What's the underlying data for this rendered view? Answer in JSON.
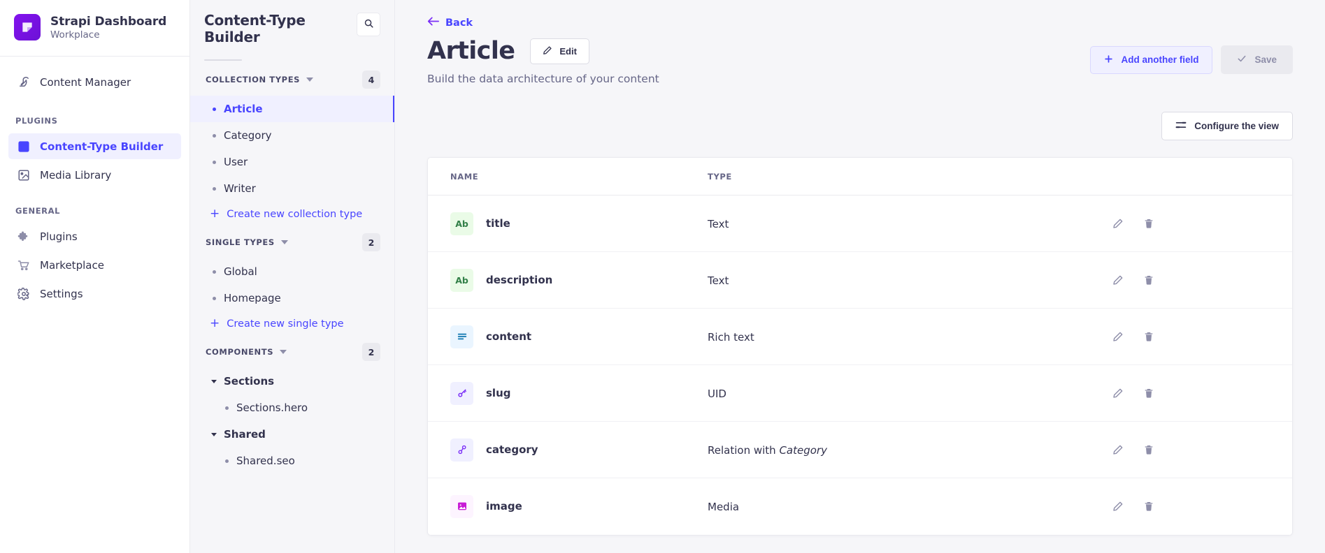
{
  "brand": {
    "title": "Strapi Dashboard",
    "subtitle": "Workplace",
    "logo_icon": "strapi-logo-icon",
    "accent": "#4945ff",
    "brand_purple": "#7b2ff7"
  },
  "mainnav": {
    "top_items": [
      {
        "label": "Content Manager",
        "icon": "feather-icon"
      }
    ],
    "groups": [
      {
        "label": "PLUGINS",
        "items": [
          {
            "label": "Content-Type Builder",
            "icon": "layout-icon",
            "active": true
          },
          {
            "label": "Media Library",
            "icon": "image-icon",
            "active": false
          }
        ]
      },
      {
        "label": "GENERAL",
        "items": [
          {
            "label": "Plugins",
            "icon": "puzzle-icon",
            "active": false
          },
          {
            "label": "Marketplace",
            "icon": "shopping-cart-icon",
            "active": false
          },
          {
            "label": "Settings",
            "icon": "gear-icon",
            "active": false
          }
        ]
      }
    ]
  },
  "subnav": {
    "title": "Content-Type Builder",
    "search_icon": "search-icon",
    "sections": [
      {
        "title": "COLLECTION TYPES",
        "count": "4",
        "items": [
          {
            "label": "Article",
            "active": true
          },
          {
            "label": "Category",
            "active": false
          },
          {
            "label": "User",
            "active": false
          },
          {
            "label": "Writer",
            "active": false
          }
        ],
        "create_label": "Create new collection type"
      },
      {
        "title": "SINGLE TYPES",
        "count": "2",
        "items": [
          {
            "label": "Global",
            "active": false
          },
          {
            "label": "Homepage",
            "active": false
          }
        ],
        "create_label": "Create new single type"
      }
    ],
    "components": {
      "title": "COMPONENTS",
      "count": "2",
      "groups": [
        {
          "label": "Sections",
          "items": [
            {
              "label": "Sections.hero"
            }
          ]
        },
        {
          "label": "Shared",
          "items": [
            {
              "label": "Shared.seo"
            }
          ]
        }
      ]
    }
  },
  "main": {
    "back_label": "Back",
    "title": "Article",
    "edit_label": "Edit",
    "subtitle": "Build the data architecture of your content",
    "add_field_label": "Add another field",
    "save_label": "Save",
    "configure_label": "Configure the view",
    "table": {
      "headers": {
        "name": "NAME",
        "type": "TYPE"
      },
      "rows": [
        {
          "name": "title",
          "type": "Text",
          "type_rel": "",
          "icon_label": "Ab",
          "icon_kind": "text",
          "bg": "#eafbe7",
          "fg": "#328048"
        },
        {
          "name": "description",
          "type": "Text",
          "type_rel": "",
          "icon_label": "Ab",
          "icon_kind": "text",
          "bg": "#eafbe7",
          "fg": "#328048"
        },
        {
          "name": "content",
          "type": "Rich text",
          "type_rel": "",
          "icon_label": "",
          "icon_kind": "richtext",
          "bg": "#eaf5ff",
          "fg": "#0c75af"
        },
        {
          "name": "slug",
          "type": "UID",
          "type_rel": "",
          "icon_label": "",
          "icon_kind": "uid",
          "bg": "#f0f0ff",
          "fg": "#7b2ff7"
        },
        {
          "name": "category",
          "type": "Relation with",
          "type_rel": "Category",
          "icon_label": "",
          "icon_kind": "relation",
          "bg": "#f0f0ff",
          "fg": "#7b2ff7"
        },
        {
          "name": "image",
          "type": "Media",
          "type_rel": "",
          "icon_label": "",
          "icon_kind": "media",
          "bg": "#fdf4ff",
          "fg": "#c81bd6"
        }
      ],
      "row_actions": {
        "edit": "pencil-icon",
        "delete": "trash-icon"
      }
    }
  }
}
